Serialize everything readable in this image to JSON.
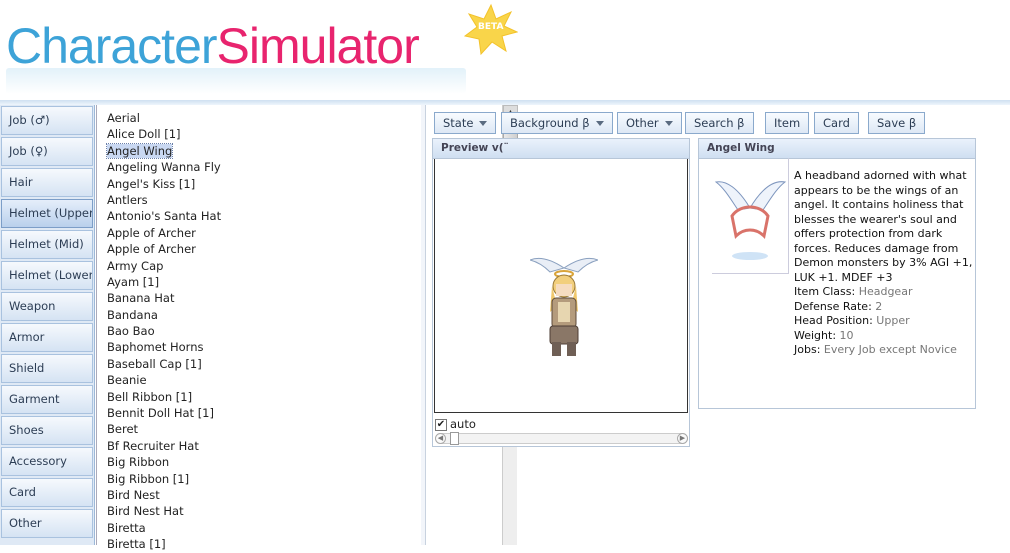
{
  "header": {
    "logo_part1": "Character",
    "logo_part2": "Simulator",
    "logo_part3": "r",
    "beta_badge": "BETA"
  },
  "categories": [
    {
      "label": "Job (♂)"
    },
    {
      "label": "Job (♀)"
    },
    {
      "label": "Hair"
    },
    {
      "label": "Helmet (Upper)",
      "active": true
    },
    {
      "label": "Helmet (Mid)"
    },
    {
      "label": "Helmet (Lower)"
    },
    {
      "label": "Weapon"
    },
    {
      "label": "Armor"
    },
    {
      "label": "Shield"
    },
    {
      "label": "Garment"
    },
    {
      "label": "Shoes"
    },
    {
      "label": "Accessory"
    },
    {
      "label": "Card"
    },
    {
      "label": "Other"
    }
  ],
  "items": [
    "Aerial",
    "Alice Doll [1]",
    "Angel Wing",
    "Angeling Wanna Fly",
    "Angel's Kiss [1]",
    "Antlers",
    "Antonio's Santa Hat",
    "Apple of Archer",
    "Apple of Archer",
    "Army Cap",
    "Ayam [1]",
    "Banana Hat",
    "Bandana",
    "Bao Bao",
    "Baphomet Horns",
    "Baseball Cap [1]",
    "Beanie",
    "Bell Ribbon [1]",
    "Bennit Doll Hat [1]",
    "Beret",
    "Bf Recruiter Hat",
    "Big Ribbon",
    "Big Ribbon [1]",
    "Bird Nest",
    "Bird Nest Hat",
    "Biretta",
    "Biretta [1]"
  ],
  "selected_item": "Angel Wing",
  "toolbar": {
    "state": "State",
    "background": "Background β",
    "other": "Other",
    "search": "Search β",
    "item": "Item",
    "card": "Card",
    "save": "Save β"
  },
  "preview": {
    "title": "Preview v(¨",
    "auto_label": "auto",
    "auto_checked": true
  },
  "detail": {
    "title": "Angel Wing",
    "description": "A headband adorned with what appears to be the wings of an angel. It contains holiness that blesses the wearer's soul and offers protection from dark forces. Reduces damage from Demon monsters by 3% AGI +1, LUK +1. MDEF +3",
    "item_class_label": "Item Class:",
    "item_class": "Headgear",
    "defense_label": "Defense Rate:",
    "defense": "2",
    "head_pos_label": "Head Position:",
    "head_pos": "Upper",
    "weight_label": "Weight:",
    "weight": "10",
    "jobs_label": "Jobs:",
    "jobs": "Every Job except Novice"
  },
  "colors": {
    "logo_blue": "#3da3d8",
    "logo_pink": "#e8246e",
    "beta_star": "#f9d54a"
  }
}
